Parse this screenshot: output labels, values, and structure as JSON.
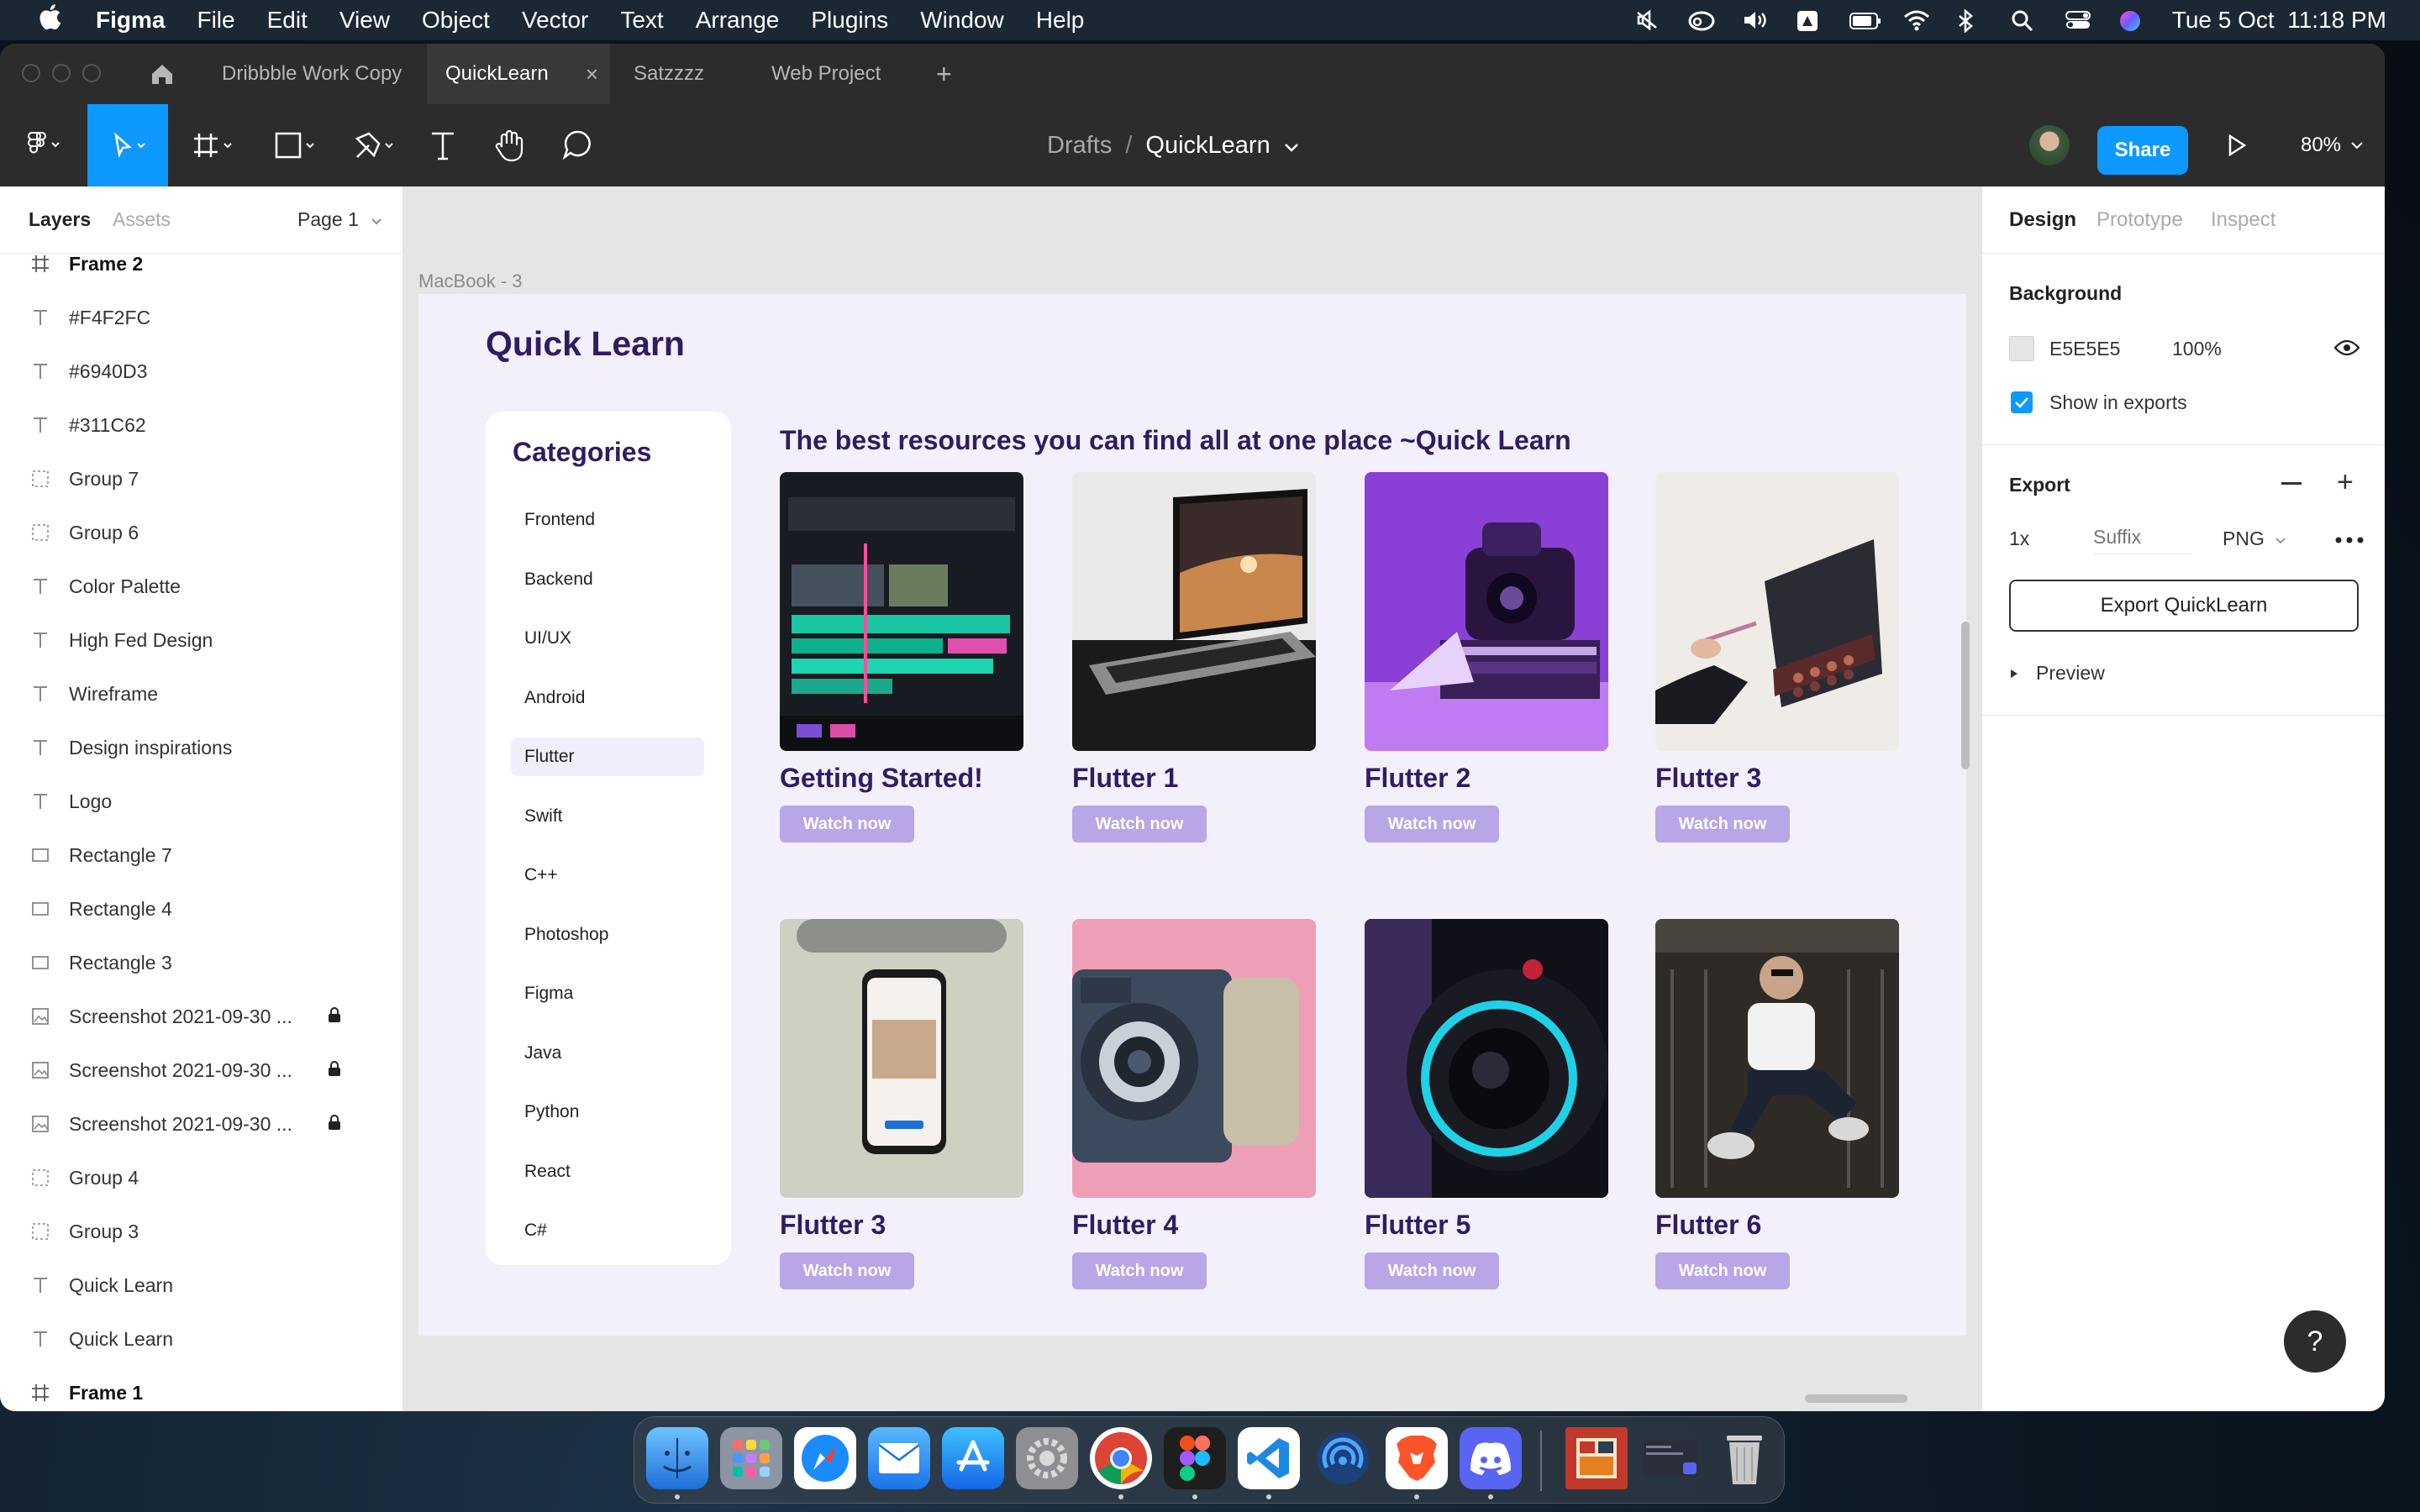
{
  "menubar": {
    "app": "Figma",
    "items": [
      "File",
      "Edit",
      "View",
      "Object",
      "Vector",
      "Text",
      "Arrange",
      "Plugins",
      "Window",
      "Help"
    ],
    "clock": "Tue 5 Oct  11:18 PM"
  },
  "tabs": [
    {
      "label": "Dribbble Work Copy",
      "active": false
    },
    {
      "label": "QuickLearn",
      "active": true
    },
    {
      "label": "Satzzzz",
      "active": false
    },
    {
      "label": "Web Project",
      "active": false
    }
  ],
  "toolbar": {
    "breadcrumb_parent": "Drafts",
    "breadcrumb_sep": "/",
    "breadcrumb_file": "QuickLearn",
    "share_label": "Share",
    "zoom": "80%"
  },
  "left_panel": {
    "tab_layers": "Layers",
    "tab_assets": "Assets",
    "page": "Page 1",
    "layers": [
      {
        "type": "frame",
        "label": "Frame 2",
        "bold": true
      },
      {
        "type": "text",
        "label": "#F4F2FC"
      },
      {
        "type": "text",
        "label": "#6940D3"
      },
      {
        "type": "text",
        "label": "#311C62"
      },
      {
        "type": "group",
        "label": "Group 7"
      },
      {
        "type": "group",
        "label": "Group 6"
      },
      {
        "type": "text",
        "label": "Color Palette"
      },
      {
        "type": "text",
        "label": "High Fed Design"
      },
      {
        "type": "text",
        "label": "Wireframe"
      },
      {
        "type": "text",
        "label": "Design inspirations"
      },
      {
        "type": "text",
        "label": "Logo"
      },
      {
        "type": "rect",
        "label": "Rectangle 7"
      },
      {
        "type": "rect",
        "label": "Rectangle 4"
      },
      {
        "type": "rect",
        "label": "Rectangle 3"
      },
      {
        "type": "image",
        "label": "Screenshot 2021-09-30 ...",
        "locked": true
      },
      {
        "type": "image",
        "label": "Screenshot 2021-09-30 ...",
        "locked": true
      },
      {
        "type": "image",
        "label": "Screenshot 2021-09-30 ...",
        "locked": true
      },
      {
        "type": "group",
        "label": "Group 4"
      },
      {
        "type": "group",
        "label": "Group 3"
      },
      {
        "type": "text",
        "label": "Quick Learn"
      },
      {
        "type": "text",
        "label": "Quick Learn"
      },
      {
        "type": "frame",
        "label": "Frame 1",
        "bold": true
      }
    ]
  },
  "canvas": {
    "frame_label": "MacBook - 3",
    "logo": "Quick Learn",
    "categories_title": "Categories",
    "categories": [
      "Frontend",
      "Backend",
      "UI/UX",
      "Android",
      "Flutter",
      "Swift",
      "C++",
      "Photoshop",
      "Figma",
      "Java",
      "Python",
      "React",
      "C#"
    ],
    "selected_category": "Flutter",
    "headline": "The best resources you can find all at one place ~Quick Learn",
    "cards": [
      {
        "title": "Getting Started!",
        "button": "Watch now",
        "image": "video-editor-photo"
      },
      {
        "title": "Flutter 1",
        "button": "Watch now",
        "image": "laptop-photo"
      },
      {
        "title": "Flutter 2",
        "button": "Watch now",
        "image": "purple-camera-photo"
      },
      {
        "title": "Flutter 3",
        "button": "Watch now",
        "image": "makeup-palette-photo"
      },
      {
        "title": "Flutter 3",
        "button": "Watch now",
        "image": "phone-photo"
      },
      {
        "title": "Flutter 4",
        "button": "Watch now",
        "image": "retro-camera-photo"
      },
      {
        "title": "Flutter 5",
        "button": "Watch now",
        "image": "camera-lens-photo"
      },
      {
        "title": "Flutter 6",
        "button": "Watch now",
        "image": "man-sitting-photo"
      }
    ]
  },
  "right_panel": {
    "tab_design": "Design",
    "tab_prototype": "Prototype",
    "tab_inspect": "Inspect",
    "background_title": "Background",
    "background_hex": "E5E5E5",
    "background_opacity": "100%",
    "show_in_exports": "Show in exports",
    "export_title": "Export",
    "export_scale": "1x",
    "export_suffix_placeholder": "Suffix",
    "export_format": "PNG",
    "export_button": "Export QuickLearn",
    "preview_label": "Preview"
  },
  "help_label": "?",
  "colors": {
    "figma_blue": "#0d99ff",
    "brand_dark": "#311c62",
    "brand_light": "#f3f0fc",
    "button_purple": "#b9a6e6",
    "canvas_bg": "#e5e5e5"
  },
  "dock": [
    "Finder",
    "Launchpad",
    "Safari",
    "Mail",
    "App Store",
    "System Preferences",
    "Chrome",
    "Figma",
    "VS Code",
    "AirDrop",
    "Brave",
    "Discord",
    "Recent Document",
    "Recent Window",
    "Trash"
  ]
}
